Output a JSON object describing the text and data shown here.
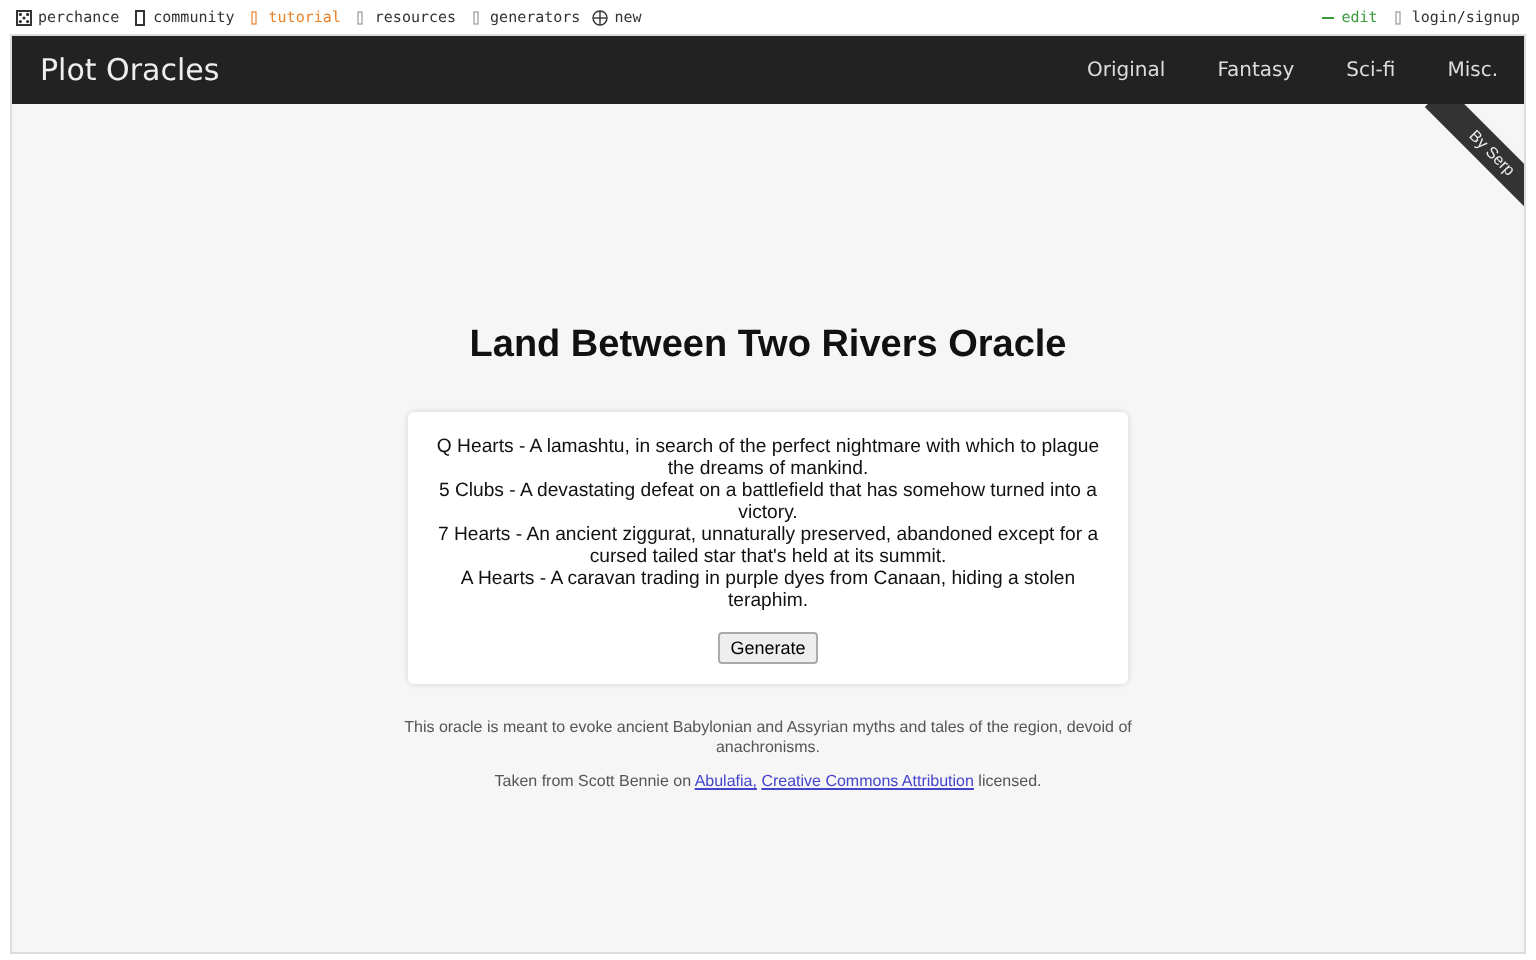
{
  "top_links": [
    {
      "label": "perchance",
      "selected": false
    },
    {
      "label": "community",
      "selected": false
    },
    {
      "label": "tutorial",
      "selected": true
    },
    {
      "label": "resources",
      "selected": false
    },
    {
      "label": "generators",
      "selected": false
    },
    {
      "label": "new",
      "selected": false
    }
  ],
  "account_links": [
    {
      "label": "edit",
      "kind": "edit"
    },
    {
      "label": "login/signup",
      "kind": "login"
    }
  ],
  "header": {
    "title": "Plot Oracles",
    "nav": [
      "Original",
      "Fantasy",
      "Sci-fi",
      "Misc."
    ],
    "ribbon": "By Serp"
  },
  "heading": "Land Between Two Rivers Oracle",
  "results": [
    "Q Hearts - A lamashtu, in search of the perfect nightmare with which to plague the dreams of mankind.",
    "5 Clubs - A devastating defeat on a battlefield that has somehow turned into a victory.",
    "7 Hearts - An ancient ziggurat, unnaturally preserved, abandoned except for a cursed tailed star that's held at its summit.",
    "A Hearts - A caravan trading in purple dyes from Canaan, hiding a stolen teraphim."
  ],
  "generate_button": "Generate",
  "description": "This oracle is meant to evoke ancient Babylonian and Assyrian myths and tales of the region, devoid of anachronisms.",
  "credits": {
    "before": "Taken from Scott Bennie on ",
    "links": [
      "Abulafia,",
      "Creative Commons Attribution"
    ],
    "after": " licensed."
  }
}
